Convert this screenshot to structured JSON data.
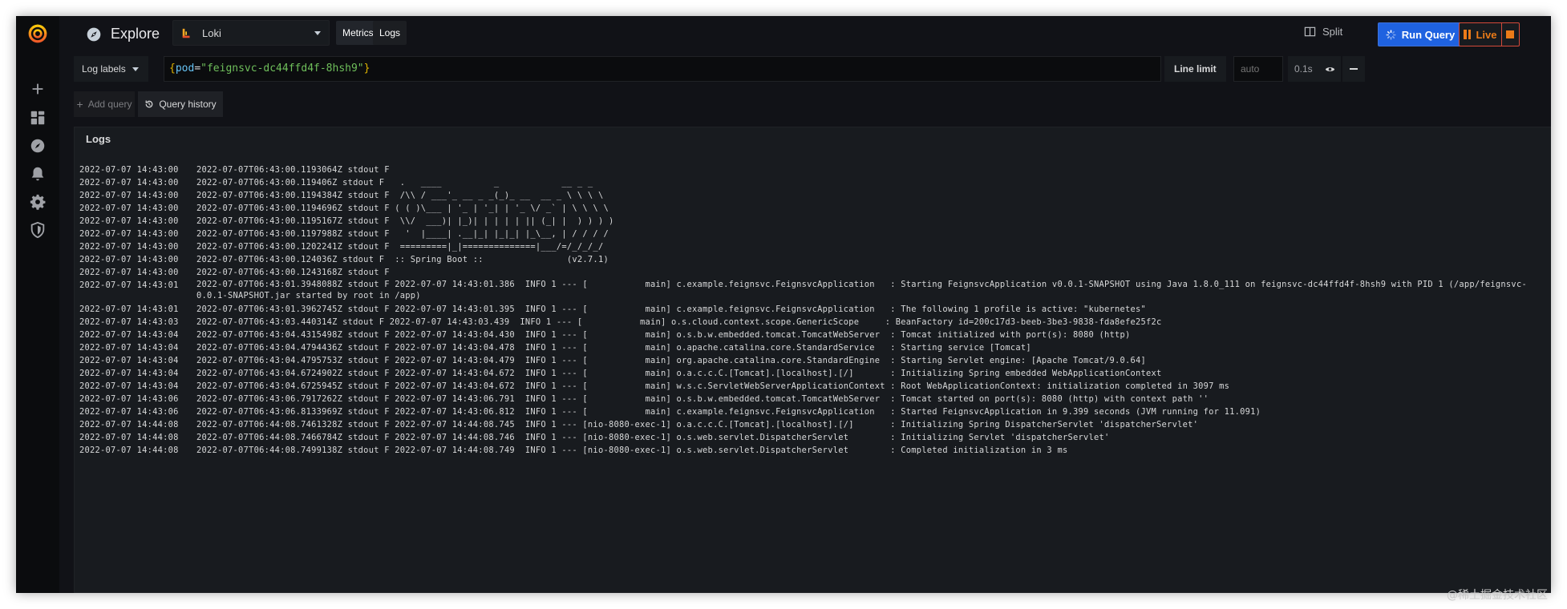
{
  "app": {
    "title": "Explore",
    "datasource": "Loki",
    "tabs": [
      "Metrics",
      "Logs"
    ]
  },
  "toolbar": {
    "split_label": "Split",
    "run_query_label": "Run Query",
    "live_label": "Live"
  },
  "query": {
    "labels_button": "Log labels",
    "expression": {
      "open": "{",
      "key": "pod",
      "eq": "=",
      "value": "\"feignsvc-dc44ffd4f-8hsh9\"",
      "close": "}"
    },
    "line_limit_label": "Line limit",
    "line_limit_placeholder": "auto",
    "query_time": "0.1s",
    "add_query_label": "Add query",
    "query_history_label": "Query history"
  },
  "logs": {
    "title": "Logs",
    "rows": [
      {
        "ts": "2022-07-07 14:43:00",
        "msg": "2022-07-07T06:43:00.1193064Z stdout F"
      },
      {
        "ts": "2022-07-07 14:43:00",
        "msg": "2022-07-07T06:43:00.119406Z stdout F   .   ____          _            __ _ _"
      },
      {
        "ts": "2022-07-07 14:43:00",
        "msg": "2022-07-07T06:43:00.1194384Z stdout F  /\\\\ / ___'_ __ _ _(_)_ __  __ _ \\ \\ \\ \\"
      },
      {
        "ts": "2022-07-07 14:43:00",
        "msg": "2022-07-07T06:43:00.1194696Z stdout F ( ( )\\___ | '_ | '_| | '_ \\/ _` | \\ \\ \\ \\"
      },
      {
        "ts": "2022-07-07 14:43:00",
        "msg": "2022-07-07T06:43:00.1195167Z stdout F  \\\\/  ___)| |_)| | | | | || (_| |  ) ) ) )"
      },
      {
        "ts": "2022-07-07 14:43:00",
        "msg": "2022-07-07T06:43:00.1197988Z stdout F   '  |____| .__|_| |_|_| |_\\__, | / / / /"
      },
      {
        "ts": "2022-07-07 14:43:00",
        "msg": "2022-07-07T06:43:00.1202241Z stdout F  =========|_|==============|___/=/_/_/_/"
      },
      {
        "ts": "2022-07-07 14:43:00",
        "msg": "2022-07-07T06:43:00.124036Z stdout F  :: Spring Boot ::                (v2.7.1)"
      },
      {
        "ts": "2022-07-07 14:43:00",
        "msg": "2022-07-07T06:43:00.1243168Z stdout F"
      },
      {
        "ts": "2022-07-07 14:43:01",
        "msg": "2022-07-07T06:43:01.3948088Z stdout F 2022-07-07 14:43:01.386  INFO 1 --- [           main] c.example.feignsvc.FeignsvcApplication   : Starting FeignsvcApplication v0.0.1-SNAPSHOT using Java 1.8.0_111 on feignsvc-dc44ffd4f-8hsh9 with PID 1 (/app/feignsvc-0.0.1-SNAPSHOT.jar started by root in /app)"
      },
      {
        "ts": "2022-07-07 14:43:01",
        "msg": "2022-07-07T06:43:01.3962745Z stdout F 2022-07-07 14:43:01.395  INFO 1 --- [           main] c.example.feignsvc.FeignsvcApplication   : The following 1 profile is active: \"kubernetes\""
      },
      {
        "ts": "2022-07-07 14:43:03",
        "msg": "2022-07-07T06:43:03.440314Z stdout F 2022-07-07 14:43:03.439  INFO 1 --- [           main] o.s.cloud.context.scope.GenericScope     : BeanFactory id=200c17d3-beeb-3be3-9838-fda8efe25f2c"
      },
      {
        "ts": "2022-07-07 14:43:04",
        "msg": "2022-07-07T06:43:04.4315498Z stdout F 2022-07-07 14:43:04.430  INFO 1 --- [           main] o.s.b.w.embedded.tomcat.TomcatWebServer  : Tomcat initialized with port(s): 8080 (http)"
      },
      {
        "ts": "2022-07-07 14:43:04",
        "msg": "2022-07-07T06:43:04.4794436Z stdout F 2022-07-07 14:43:04.478  INFO 1 --- [           main] o.apache.catalina.core.StandardService   : Starting service [Tomcat]"
      },
      {
        "ts": "2022-07-07 14:43:04",
        "msg": "2022-07-07T06:43:04.4795753Z stdout F 2022-07-07 14:43:04.479  INFO 1 --- [           main] org.apache.catalina.core.StandardEngine  : Starting Servlet engine: [Apache Tomcat/9.0.64]"
      },
      {
        "ts": "2022-07-07 14:43:04",
        "msg": "2022-07-07T06:43:04.6724902Z stdout F 2022-07-07 14:43:04.672  INFO 1 --- [           main] o.a.c.c.C.[Tomcat].[localhost].[/]       : Initializing Spring embedded WebApplicationContext"
      },
      {
        "ts": "2022-07-07 14:43:04",
        "msg": "2022-07-07T06:43:04.6725945Z stdout F 2022-07-07 14:43:04.672  INFO 1 --- [           main] w.s.c.ServletWebServerApplicationContext : Root WebApplicationContext: initialization completed in 3097 ms"
      },
      {
        "ts": "2022-07-07 14:43:06",
        "msg": "2022-07-07T06:43:06.7917262Z stdout F 2022-07-07 14:43:06.791  INFO 1 --- [           main] o.s.b.w.embedded.tomcat.TomcatWebServer  : Tomcat started on port(s): 8080 (http) with context path ''"
      },
      {
        "ts": "2022-07-07 14:43:06",
        "msg": "2022-07-07T06:43:06.8133969Z stdout F 2022-07-07 14:43:06.812  INFO 1 --- [           main] c.example.feignsvc.FeignsvcApplication   : Started FeignsvcApplication in 9.399 seconds (JVM running for 11.091)"
      },
      {
        "ts": "2022-07-07 14:44:08",
        "msg": "2022-07-07T06:44:08.7461328Z stdout F 2022-07-07 14:44:08.745  INFO 1 --- [nio-8080-exec-1] o.a.c.c.C.[Tomcat].[localhost].[/]       : Initializing Spring DispatcherServlet 'dispatcherServlet'"
      },
      {
        "ts": "2022-07-07 14:44:08",
        "msg": "2022-07-07T06:44:08.7466784Z stdout F 2022-07-07 14:44:08.746  INFO 1 --- [nio-8080-exec-1] o.s.web.servlet.DispatcherServlet        : Initializing Servlet 'dispatcherServlet'"
      },
      {
        "ts": "2022-07-07 14:44:08",
        "msg": "2022-07-07T06:44:08.7499138Z stdout F 2022-07-07 14:44:08.749  INFO 1 --- [nio-8080-exec-1] o.s.web.servlet.DispatcherServlet        : Completed initialization in 3 ms"
      }
    ]
  },
  "watermark": "@稀土掘金技术社区",
  "colors": {
    "background": "#111217",
    "panel": "#181b1f",
    "primary": "#1f62e0",
    "live": "#eb7b18",
    "brace": "#e0b400",
    "label_key": "#66c3f4",
    "label_value": "#6fbf5b"
  }
}
